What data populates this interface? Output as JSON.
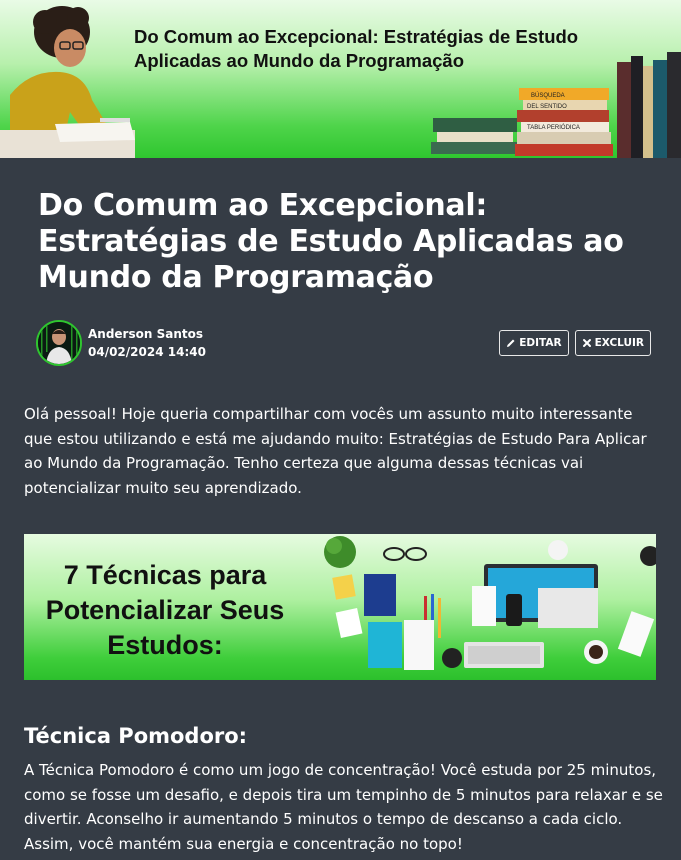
{
  "banner": {
    "title": "Do Comum ao Excepcional: Estratégias de Estudo Aplicadas ao Mundo da Programação",
    "book_spine_texts": [
      "BÚSQUEDA",
      "DEL SENTIDO",
      "TABLA PERIÓDICA"
    ]
  },
  "article": {
    "title": "Do Comum ao Excepcional: Estratégias de Estudo Aplicadas ao Mundo da Programação",
    "author": "Anderson Santos",
    "date": "04/02/2024 14:40",
    "edit_label": "EDITAR",
    "delete_label": "EXCLUIR",
    "intro": "Olá pessoal! Hoje queria compartilhar com vocês um assunto muito interessante que estou utilizando e está me ajudando muito: Estratégias de Estudo Para Aplicar ao Mundo da Programação. Tenho certeza que alguma dessas técnicas vai potencializar muito seu aprendizado."
  },
  "promo": {
    "text": "7 Técnicas para Potencializar Seus Estudos:"
  },
  "section": {
    "title": "Técnica Pomodoro:",
    "body": "A Técnica Pomodoro é como um jogo de concentração! Você estuda por 25 minutos, como se fosse um desafio, e depois tira um tempinho de 5 minutos para relaxar e se divertir. Aconselho ir aumentando 5 minutos o tempo de descanso a cada ciclo. Assim, você mantém sua energia e concentração no topo!"
  },
  "colors": {
    "background": "#353c45",
    "accent_green": "#2fc62f",
    "text": "#ffffff"
  },
  "icons": [
    "pencil-icon",
    "close-icon"
  ]
}
